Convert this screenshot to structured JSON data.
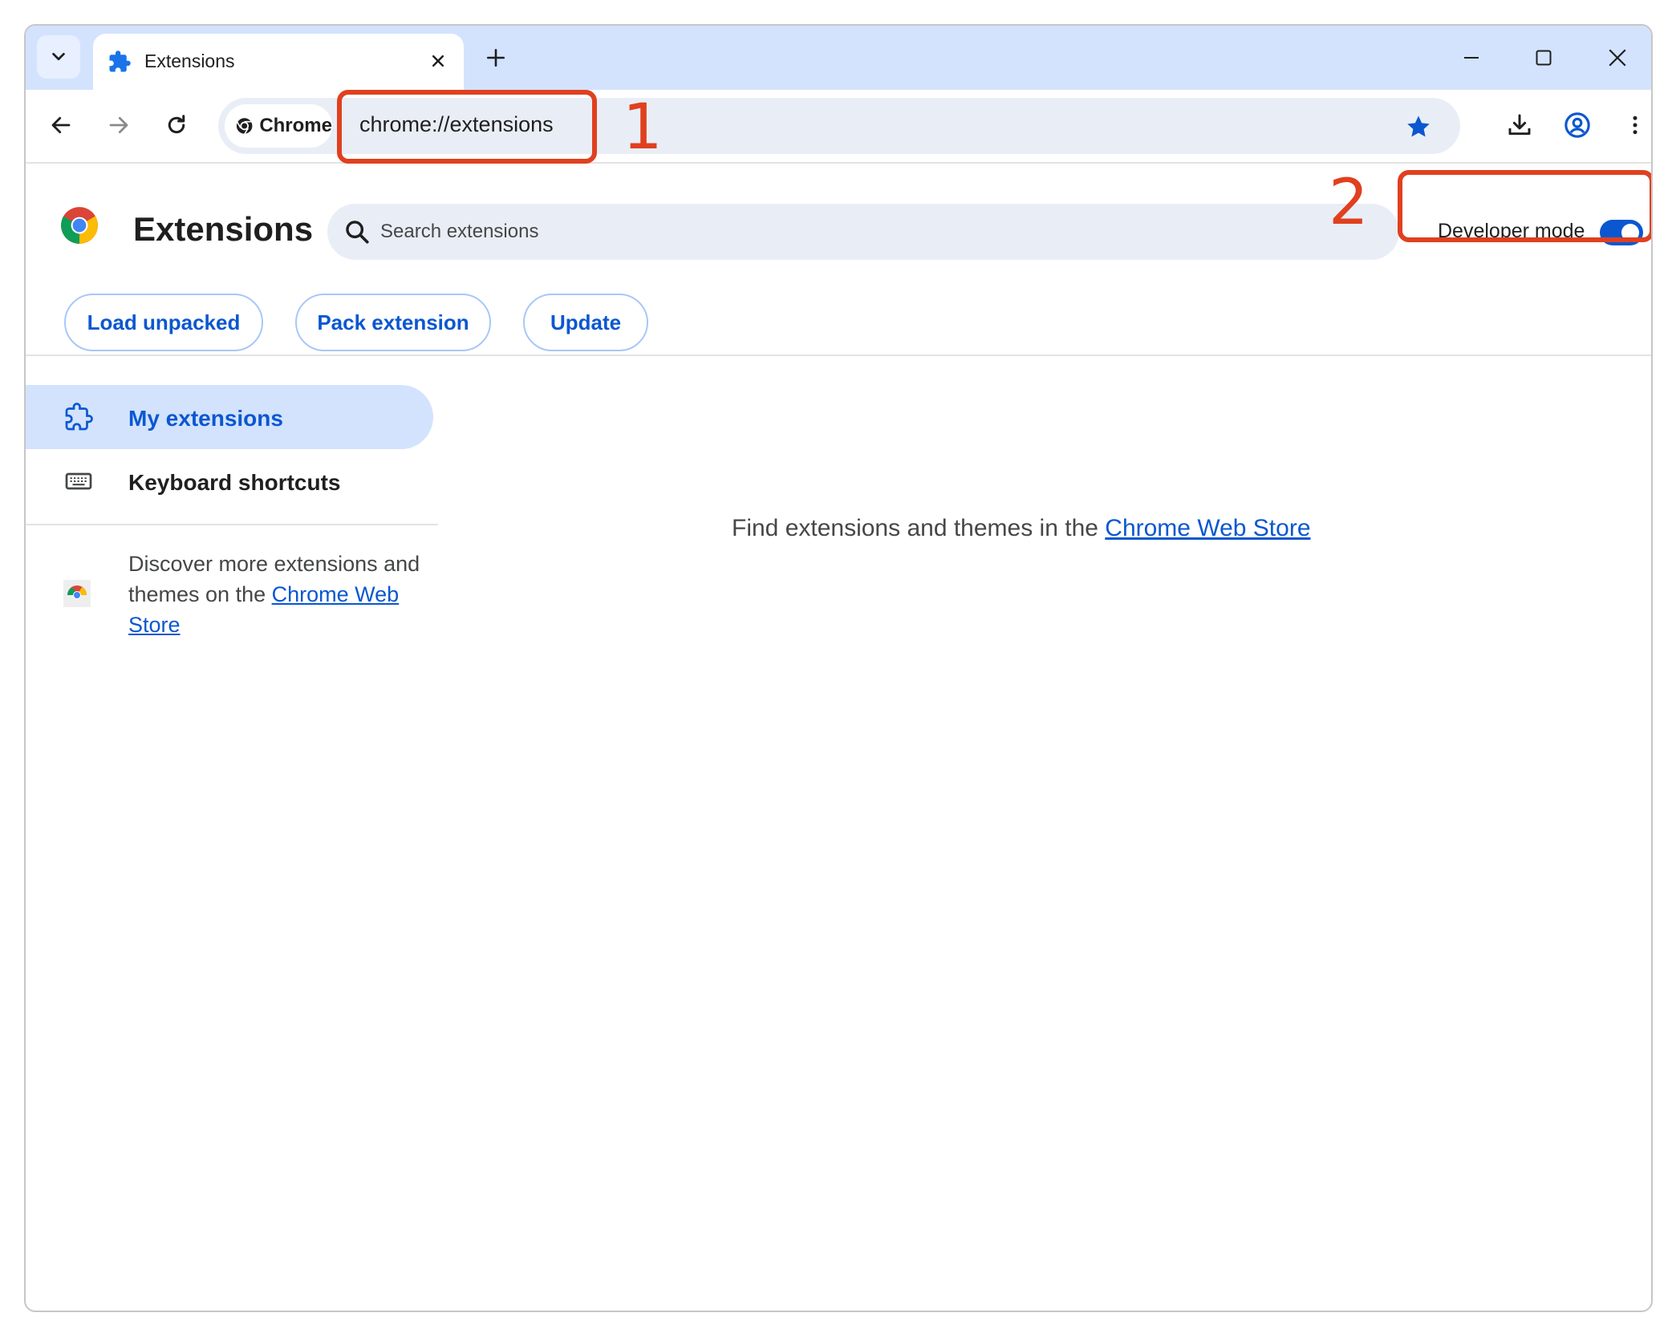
{
  "tab": {
    "title": "Extensions"
  },
  "toolbar": {
    "chip_label": "Chrome",
    "url": "chrome://extensions"
  },
  "header": {
    "title": "Extensions",
    "search_placeholder": "Search extensions",
    "developer_mode_label": "Developer mode",
    "developer_mode_on": true
  },
  "dev_buttons": {
    "load_unpacked": "Load unpacked",
    "pack_extension": "Pack extension",
    "update": "Update"
  },
  "sidebar": {
    "items": [
      {
        "label": "My extensions",
        "icon": "puzzle-icon",
        "active": true
      },
      {
        "label": "Keyboard shortcuts",
        "icon": "keyboard-icon",
        "active": false
      }
    ],
    "discover_prefix": "Discover more extensions and themes on the ",
    "discover_link": "Chrome Web Store"
  },
  "main": {
    "empty_prefix": "Find extensions and themes in the ",
    "empty_link": "Chrome Web Store"
  },
  "annotations": {
    "first": "1",
    "second": "2"
  },
  "colors": {
    "accent": "#0b57d0",
    "tabstrip": "#d3e3fd",
    "annotation": "#e0401f"
  }
}
